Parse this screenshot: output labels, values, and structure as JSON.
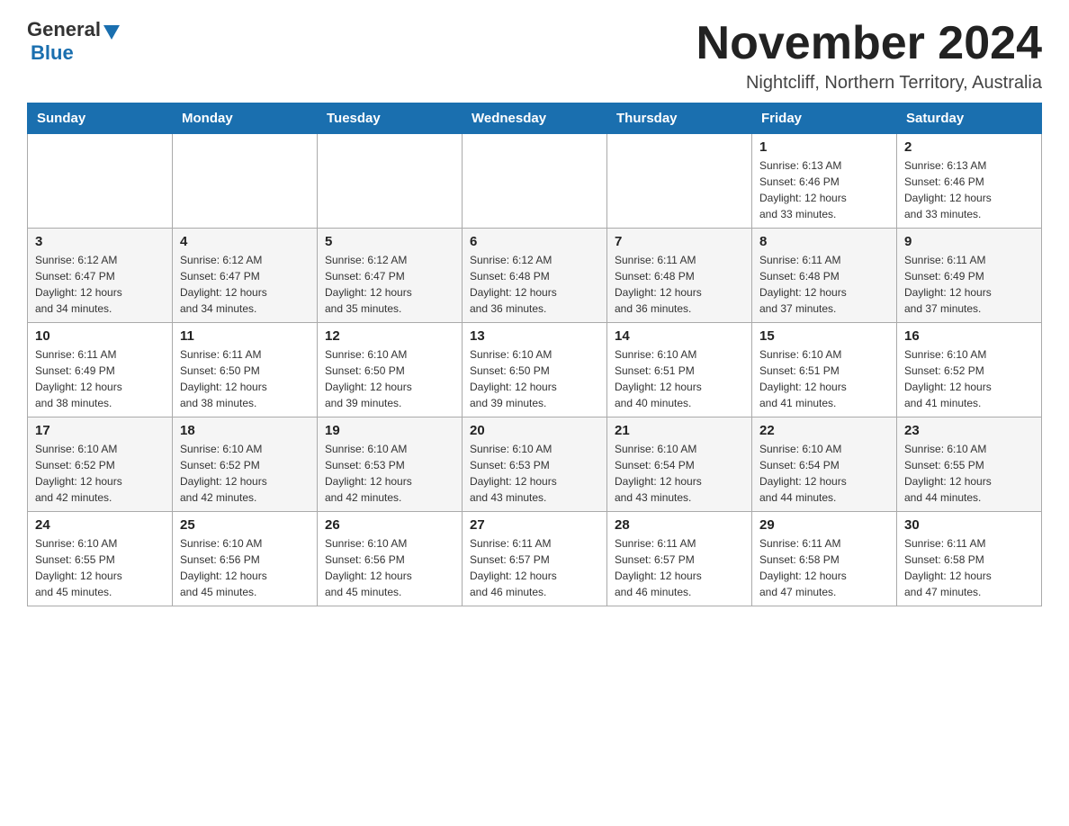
{
  "header": {
    "logo_general": "General",
    "logo_blue": "Blue",
    "month_title": "November 2024",
    "location": "Nightcliff, Northern Territory, Australia"
  },
  "calendar": {
    "days_of_week": [
      "Sunday",
      "Monday",
      "Tuesday",
      "Wednesday",
      "Thursday",
      "Friday",
      "Saturday"
    ],
    "weeks": [
      [
        {
          "day": "",
          "info": ""
        },
        {
          "day": "",
          "info": ""
        },
        {
          "day": "",
          "info": ""
        },
        {
          "day": "",
          "info": ""
        },
        {
          "day": "",
          "info": ""
        },
        {
          "day": "1",
          "info": "Sunrise: 6:13 AM\nSunset: 6:46 PM\nDaylight: 12 hours\nand 33 minutes."
        },
        {
          "day": "2",
          "info": "Sunrise: 6:13 AM\nSunset: 6:46 PM\nDaylight: 12 hours\nand 33 minutes."
        }
      ],
      [
        {
          "day": "3",
          "info": "Sunrise: 6:12 AM\nSunset: 6:47 PM\nDaylight: 12 hours\nand 34 minutes."
        },
        {
          "day": "4",
          "info": "Sunrise: 6:12 AM\nSunset: 6:47 PM\nDaylight: 12 hours\nand 34 minutes."
        },
        {
          "day": "5",
          "info": "Sunrise: 6:12 AM\nSunset: 6:47 PM\nDaylight: 12 hours\nand 35 minutes."
        },
        {
          "day": "6",
          "info": "Sunrise: 6:12 AM\nSunset: 6:48 PM\nDaylight: 12 hours\nand 36 minutes."
        },
        {
          "day": "7",
          "info": "Sunrise: 6:11 AM\nSunset: 6:48 PM\nDaylight: 12 hours\nand 36 minutes."
        },
        {
          "day": "8",
          "info": "Sunrise: 6:11 AM\nSunset: 6:48 PM\nDaylight: 12 hours\nand 37 minutes."
        },
        {
          "day": "9",
          "info": "Sunrise: 6:11 AM\nSunset: 6:49 PM\nDaylight: 12 hours\nand 37 minutes."
        }
      ],
      [
        {
          "day": "10",
          "info": "Sunrise: 6:11 AM\nSunset: 6:49 PM\nDaylight: 12 hours\nand 38 minutes."
        },
        {
          "day": "11",
          "info": "Sunrise: 6:11 AM\nSunset: 6:50 PM\nDaylight: 12 hours\nand 38 minutes."
        },
        {
          "day": "12",
          "info": "Sunrise: 6:10 AM\nSunset: 6:50 PM\nDaylight: 12 hours\nand 39 minutes."
        },
        {
          "day": "13",
          "info": "Sunrise: 6:10 AM\nSunset: 6:50 PM\nDaylight: 12 hours\nand 39 minutes."
        },
        {
          "day": "14",
          "info": "Sunrise: 6:10 AM\nSunset: 6:51 PM\nDaylight: 12 hours\nand 40 minutes."
        },
        {
          "day": "15",
          "info": "Sunrise: 6:10 AM\nSunset: 6:51 PM\nDaylight: 12 hours\nand 41 minutes."
        },
        {
          "day": "16",
          "info": "Sunrise: 6:10 AM\nSunset: 6:52 PM\nDaylight: 12 hours\nand 41 minutes."
        }
      ],
      [
        {
          "day": "17",
          "info": "Sunrise: 6:10 AM\nSunset: 6:52 PM\nDaylight: 12 hours\nand 42 minutes."
        },
        {
          "day": "18",
          "info": "Sunrise: 6:10 AM\nSunset: 6:52 PM\nDaylight: 12 hours\nand 42 minutes."
        },
        {
          "day": "19",
          "info": "Sunrise: 6:10 AM\nSunset: 6:53 PM\nDaylight: 12 hours\nand 42 minutes."
        },
        {
          "day": "20",
          "info": "Sunrise: 6:10 AM\nSunset: 6:53 PM\nDaylight: 12 hours\nand 43 minutes."
        },
        {
          "day": "21",
          "info": "Sunrise: 6:10 AM\nSunset: 6:54 PM\nDaylight: 12 hours\nand 43 minutes."
        },
        {
          "day": "22",
          "info": "Sunrise: 6:10 AM\nSunset: 6:54 PM\nDaylight: 12 hours\nand 44 minutes."
        },
        {
          "day": "23",
          "info": "Sunrise: 6:10 AM\nSunset: 6:55 PM\nDaylight: 12 hours\nand 44 minutes."
        }
      ],
      [
        {
          "day": "24",
          "info": "Sunrise: 6:10 AM\nSunset: 6:55 PM\nDaylight: 12 hours\nand 45 minutes."
        },
        {
          "day": "25",
          "info": "Sunrise: 6:10 AM\nSunset: 6:56 PM\nDaylight: 12 hours\nand 45 minutes."
        },
        {
          "day": "26",
          "info": "Sunrise: 6:10 AM\nSunset: 6:56 PM\nDaylight: 12 hours\nand 45 minutes."
        },
        {
          "day": "27",
          "info": "Sunrise: 6:11 AM\nSunset: 6:57 PM\nDaylight: 12 hours\nand 46 minutes."
        },
        {
          "day": "28",
          "info": "Sunrise: 6:11 AM\nSunset: 6:57 PM\nDaylight: 12 hours\nand 46 minutes."
        },
        {
          "day": "29",
          "info": "Sunrise: 6:11 AM\nSunset: 6:58 PM\nDaylight: 12 hours\nand 47 minutes."
        },
        {
          "day": "30",
          "info": "Sunrise: 6:11 AM\nSunset: 6:58 PM\nDaylight: 12 hours\nand 47 minutes."
        }
      ]
    ]
  }
}
